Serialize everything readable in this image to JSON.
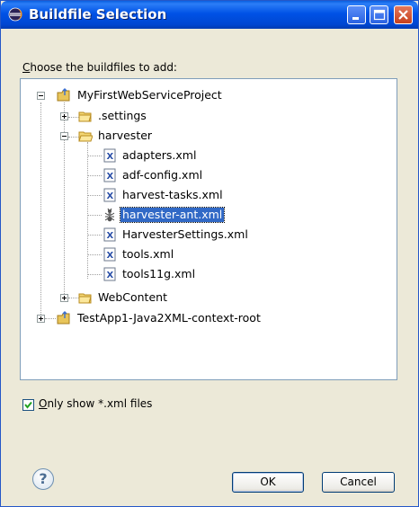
{
  "window": {
    "title": "Buildfile Selection"
  },
  "prompt": {
    "text": "hoose the buildfiles to add:",
    "mnemonic": "C"
  },
  "tree": [
    {
      "label": "MyFirstWebServiceProject",
      "icon": "project-icon",
      "state": "expanded"
    },
    {
      "label": ".settings",
      "icon": "folder-icon",
      "state": "collapsed"
    },
    {
      "label": "harvester",
      "icon": "folder-icon",
      "state": "expanded"
    },
    {
      "label": "adapters.xml",
      "icon": "xml-file-icon"
    },
    {
      "label": "adf-config.xml",
      "icon": "xml-file-icon"
    },
    {
      "label": "harvest-tasks.xml",
      "icon": "xml-file-icon"
    },
    {
      "label": "harvester-ant.xml",
      "icon": "ant-file-icon",
      "selected": true
    },
    {
      "label": "HarvesterSettings.xml",
      "icon": "xml-file-icon"
    },
    {
      "label": "tools.xml",
      "icon": "xml-file-icon"
    },
    {
      "label": "tools11g.xml",
      "icon": "xml-file-icon"
    },
    {
      "label": "WebContent",
      "icon": "folder-icon",
      "state": "collapsed"
    },
    {
      "label": "TestApp1-Java2XML-context-root",
      "icon": "project-icon",
      "state": "collapsed"
    }
  ],
  "filter": {
    "mnemonic": "O",
    "text": "nly show *.xml files",
    "checked": true
  },
  "buttons": {
    "ok": "OK",
    "cancel": "Cancel",
    "help": "?"
  },
  "colors": {
    "selection": "#3169c6",
    "titlebar": "#0052e6",
    "dialog_bg": "#ece9d8"
  }
}
